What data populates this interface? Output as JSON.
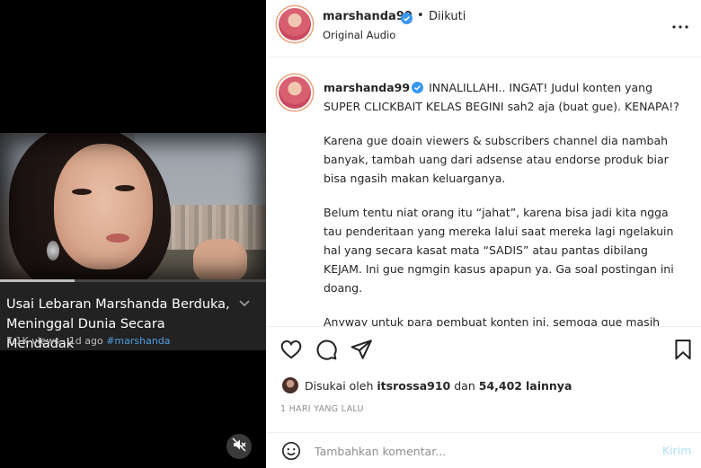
{
  "video": {
    "title": "Usai Lebaran Marshanda Berduka, Meninggal Dunia Secara Mendadak",
    "views": "7.1K views",
    "separator": "·",
    "age": "1d ago",
    "hashtag": "#marshanda",
    "progress_fraction": 0.28,
    "chevron": "chevron-down-icon",
    "mute_icon": "mute-icon"
  },
  "header": {
    "username": "marshanda99",
    "dot": "•",
    "follow_status": "Diikuti",
    "audio": "Original Audio",
    "more_icon": "more-icon"
  },
  "caption": {
    "username": "marshanda99",
    "lead": "INNALILLAHI.. INGAT! Judul konten yang SUPER CLICKBAIT KELAS BEGINI sah2 aja (buat gue). KENAPA!?",
    "paragraphs": [
      "Karena gue doain viewers & subscribers channel dia nambah banyak, tambah uang dari adsense atau endorse produk biar bisa ngasih makan keluarganya.",
      "Belum tentu niat orang itu “jahat”, karena bisa jadi kita ngga tau penderitaan yang mereka lalui saat mereka lagi ngelakuin hal yang secara kasat mata “SADIS” atau pantas dibilang KEJAM. Ini gue ngmgin kasus apapun ya. Ga soal postingan ini doang.",
      "Anyway untuk para pembuat konten ini, semoga gue masih berumur panjang (jika emang qodarNya begitu), tapi gue kirim kasih sayang dan doa buat kesulitan yang kalian lagi alami. Kalo pama gue kebetulan jadi berkah buat kalian, mungkin ini yang"
    ]
  },
  "likes": {
    "prefix": "Disukai oleh",
    "user": "itsrossa910",
    "conjunction": "dan",
    "count": "54,402",
    "suffix": "lainnya"
  },
  "timestamp": "1 HARI YANG LALU",
  "comment": {
    "placeholder": "Tambahkan komentar...",
    "post_label": "Kirim"
  },
  "colors": {
    "verified": "#3897f0",
    "link": "#4d9de0",
    "post_disabled": "#b2dffc"
  }
}
